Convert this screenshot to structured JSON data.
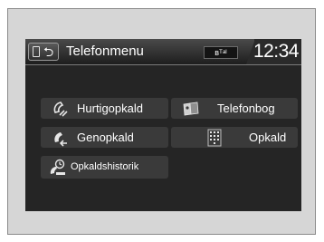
{
  "header": {
    "title": "Telefonmenu",
    "back_icon": "return-arrow",
    "back_glyph": "⮌",
    "phone_icon": "phone-icon",
    "status_indicator": "ʙᵀᵃˡ",
    "clock": "12:34"
  },
  "menu": {
    "items": [
      {
        "label": "Hurtigopkald",
        "icon": "speed-dial-icon"
      },
      {
        "label": "Telefonbog",
        "icon": "phonebook-icon"
      },
      {
        "label": "Genopkald",
        "icon": "redial-icon"
      },
      {
        "label": "Opkald",
        "icon": "keypad-icon"
      },
      {
        "label": "Opkaldshistorik",
        "icon": "call-history-icon"
      }
    ]
  },
  "colors": {
    "screen_bg": "#252525",
    "button_bg": "#3a3a3a",
    "text": "#ffffff",
    "frame_bg": "#d6d6d6"
  }
}
